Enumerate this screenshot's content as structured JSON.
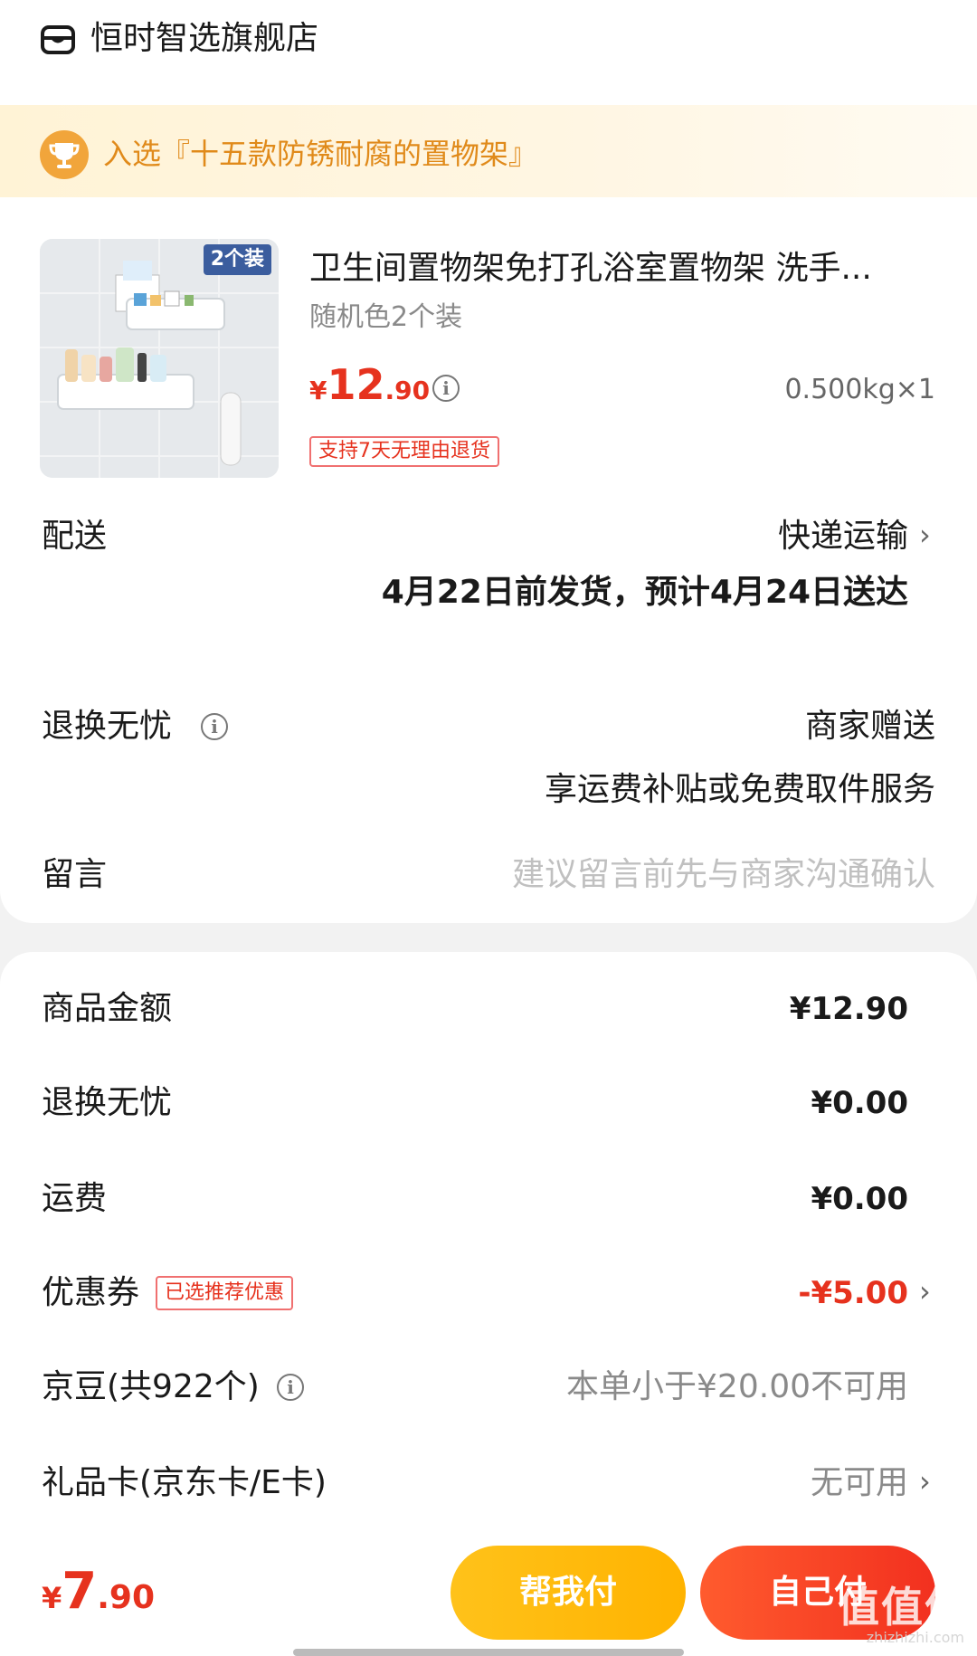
{
  "store": {
    "name": "恒时智选旗舰店"
  },
  "award": {
    "text": "入选『十五款防锈耐腐的置物架』"
  },
  "product": {
    "badge": "2个装",
    "title": "卫生间置物架免打孔浴室置物架 洗手...",
    "spec": "随机色2个装",
    "price_symbol": "¥",
    "price_int": "12",
    "price_dec": ".90",
    "weight": "0.500kg×1",
    "return_tag": "支持7天无理由退货"
  },
  "delivery": {
    "label": "配送",
    "method": "快递运输",
    "schedule": "4月22日前发货，预计4月24日送达"
  },
  "worry_free": {
    "label": "退换无忧",
    "value": "商家赠送",
    "detail": "享运费补贴或免费取件服务"
  },
  "message": {
    "label": "留言",
    "placeholder": "建议留言前先与商家沟通确认"
  },
  "summary": {
    "goods_amount": {
      "label": "商品金额",
      "value": "¥12.90"
    },
    "worry_free": {
      "label": "退换无忧",
      "value": "¥0.00"
    },
    "shipping": {
      "label": "运费",
      "value": "¥0.00"
    },
    "coupon": {
      "label": "优惠券",
      "tag": "已选推荐优惠",
      "value": "-¥5.00"
    },
    "jingdou": {
      "label": "京豆(共922个)",
      "value": "本单小于¥20.00不可用"
    },
    "gift_card": {
      "label": "礼品卡(京东卡/E卡)",
      "value": "无可用"
    }
  },
  "footer": {
    "total_symbol": "¥",
    "total_int": "7",
    "total_dec": ".90",
    "help_pay": "帮我付",
    "self_pay": "自己付",
    "watermark": "值值值",
    "watermark_url": "zhizhizhi.com"
  },
  "colors": {
    "accent": "#e6321e",
    "award_text": "#e08a1a",
    "help_btn": "#ffc21a",
    "self_btn": "#f2301f"
  },
  "icons": [
    "store-icon",
    "trophy-icon",
    "info-icon",
    "chevron-right-icon"
  ]
}
